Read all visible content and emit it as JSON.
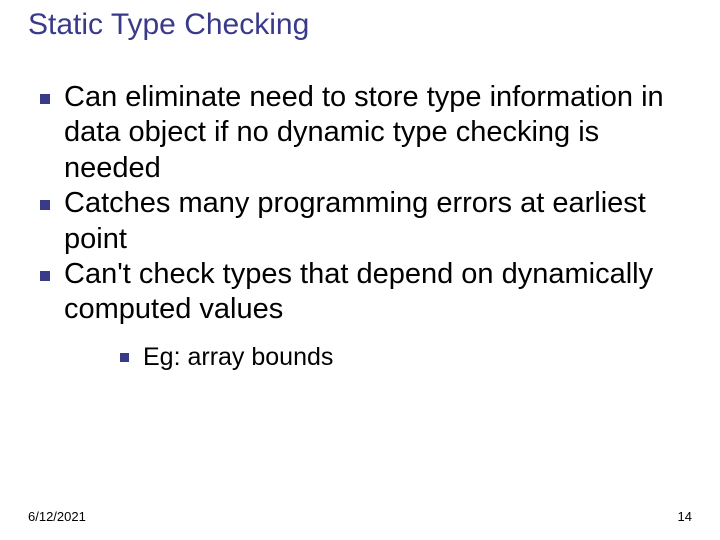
{
  "slide": {
    "title": "Static Type Checking",
    "bullets": [
      "Can eliminate need to store type information in data object if no dynamic type checking is needed",
      "Catches many programming errors at earliest point",
      "Can't check types that depend on dynamically computed values"
    ],
    "sub_bullets": [
      "Eg: array bounds"
    ],
    "footer_date": "6/12/2021",
    "footer_page": "14"
  }
}
